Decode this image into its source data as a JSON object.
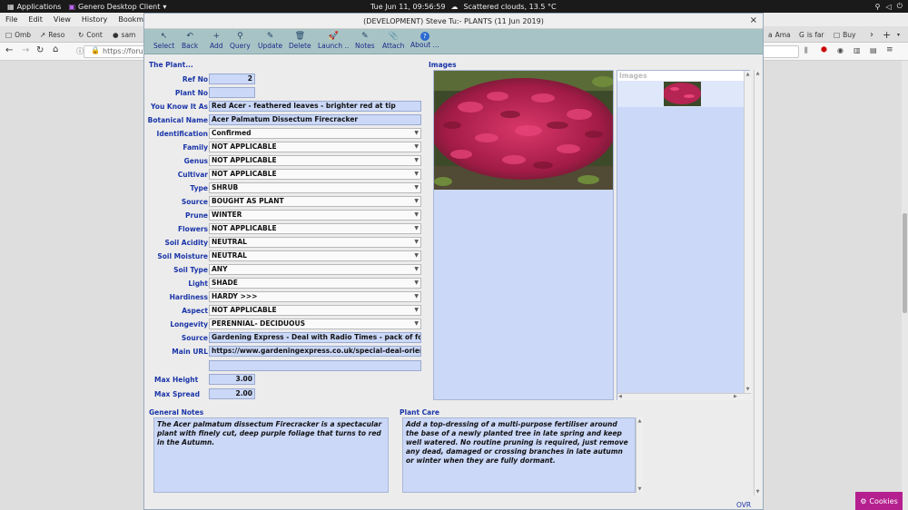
{
  "system": {
    "applications": "Applications",
    "active_app": "Genero Desktop Client",
    "clock": "Tue Jun 11, 09:56:59",
    "weather": "Scattered clouds, 13.5 °C"
  },
  "browser": {
    "menu": [
      "File",
      "Edit",
      "View",
      "History",
      "Bookmarks"
    ],
    "tabs": [
      "Omb",
      "Reso",
      "Cont",
      "sam",
      "Ama",
      "is far",
      "Buy"
    ],
    "url": "https://forum"
  },
  "window": {
    "title": "(DEVELOPMENT) Steve Tu:-  PLANTS (11 Jun 2019)",
    "close": "×"
  },
  "toolbar": [
    {
      "label": "Select",
      "icon": "↖"
    },
    {
      "label": "Back",
      "icon": "↶"
    },
    {
      "label": "Add",
      "icon": "+"
    },
    {
      "label": "Query",
      "icon": "⚲"
    },
    {
      "label": "Update",
      "icon": "✎"
    },
    {
      "label": "Delete",
      "icon": "🗑"
    },
    {
      "label": "Launch ..",
      "icon": "🚀"
    },
    {
      "label": "Notes",
      "icon": "✎"
    },
    {
      "label": "Attach",
      "icon": "📎"
    },
    {
      "label": "About ...",
      "icon": "?"
    }
  ],
  "plant": {
    "section_title": "The Plant...",
    "ref_no_label": "Ref No",
    "ref_no": "2",
    "plant_no_label": "Plant No",
    "plant_no": "",
    "known_as_label": "You Know It As",
    "known_as": "Red Acer - feathered leaves - brighter red at tip",
    "botanical_label": "Botanical Name",
    "botanical": "Acer Palmatum Dissectum Firecracker",
    "identification_label": "Identification",
    "identification": "Confirmed",
    "family_label": "Family",
    "family": "NOT APPLICABLE",
    "genus_label": "Genus",
    "genus": "NOT APPLICABLE",
    "cultivar_label": "Cultivar",
    "cultivar": "NOT APPLICABLE",
    "type_label": "Type",
    "type": "SHRUB",
    "source_label": "Source",
    "source": "BOUGHT AS PLANT",
    "prune_label": "Prune",
    "prune": "WINTER",
    "flowers_label": "Flowers",
    "flowers": "NOT APPLICABLE",
    "soil_acidity_label": "Soil Acidity",
    "soil_acidity": "NEUTRAL",
    "soil_moisture_label": "Soil Moisture",
    "soil_moisture": "NEUTRAL",
    "soil_type_label": "Soil Type",
    "soil_type": "ANY",
    "light_label": "Light",
    "light": "SHADE",
    "hardiness_label": "Hardiness",
    "hardiness": "HARDY >>>",
    "aspect_label": "Aspect",
    "aspect": "NOT APPLICABLE",
    "longevity_label": "Longevity",
    "longevity": "PERENNIAL- DECIDUOUS",
    "source_text_label": "Source",
    "source_text": "Gardening Express - Deal with Radio Times - pack of four acers",
    "main_url_label": "Main URL",
    "main_url": "https://www.gardeningexpress.co.uk/special-deal-oriental-acer",
    "extra": "",
    "max_height_label": "Max Height",
    "max_height": "3.00",
    "max_spread_label": "Max Spread",
    "max_spread": "2.00"
  },
  "images": {
    "section_title": "Images",
    "list_header": "Images"
  },
  "notes": {
    "general_title": "General Notes",
    "general_text": "The Acer palmatum dissectum Firecracker is a spectacular plant with finely cut, deep purple foliage that turns to red in the Autumn.",
    "care_title": "Plant Care",
    "care_text": "Add a top-dressing of a multi-purpose fertiliser around the base of a newly planted tree in late spring and keep well watered. No routine pruning is required, just remove any dead, damaged or crossing branches in late autumn or winter when they are fully dormant."
  },
  "status": {
    "mode": "OVR"
  },
  "cookies": "Cookies",
  "colors": {
    "accent": "#1a35a8",
    "field": "#cbd8f8",
    "toolbar": "#a8c3c5"
  }
}
